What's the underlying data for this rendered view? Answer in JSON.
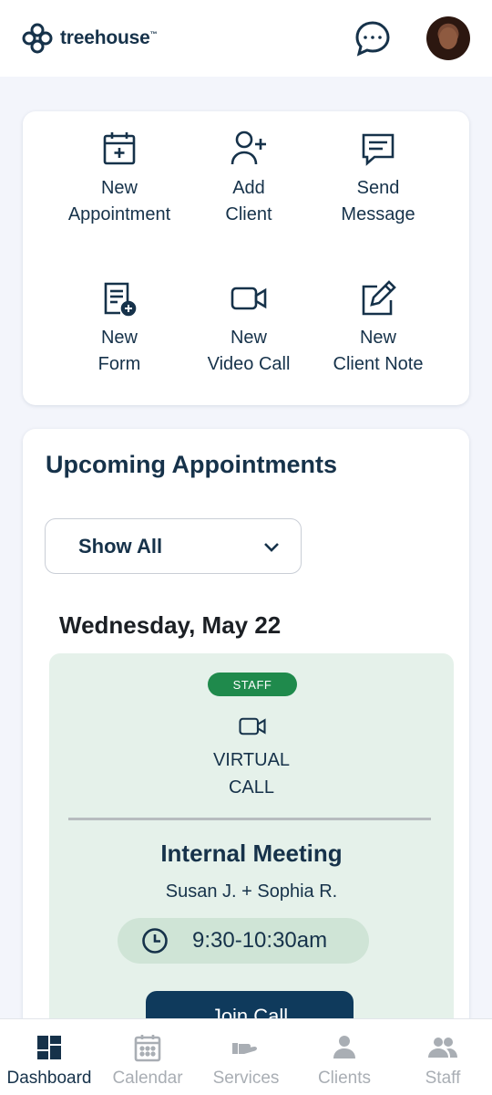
{
  "header": {
    "logo_text": "treehouse",
    "logo_mark": "™"
  },
  "quick_actions": [
    {
      "label": "New\nAppointment",
      "icon": "calendar-plus-icon"
    },
    {
      "label": "Add\nClient",
      "icon": "user-plus-icon"
    },
    {
      "label": "Send\nMessage",
      "icon": "message-icon"
    },
    {
      "label": "New\nForm",
      "icon": "form-add-icon"
    },
    {
      "label": "New\nVideo Call",
      "icon": "video-icon"
    },
    {
      "label": "New\nClient Note",
      "icon": "edit-note-icon"
    }
  ],
  "appointments": {
    "title": "Upcoming Appointments",
    "filter_value": "Show All",
    "date": "Wednesday, May 22",
    "items": [
      {
        "badge": "STAFF",
        "call_type": "VIRTUAL\nCALL",
        "title": "Internal Meeting",
        "participants": "Susan J. + Sophia R.",
        "time": "9:30-10:30am",
        "action_label": "Join Call"
      }
    ]
  },
  "bottom_nav": [
    {
      "label": "Dashboard",
      "icon": "dashboard-icon",
      "active": true
    },
    {
      "label": "Calendar",
      "icon": "calendar-icon",
      "active": false
    },
    {
      "label": "Services",
      "icon": "services-icon",
      "active": false
    },
    {
      "label": "Clients",
      "icon": "client-icon",
      "active": false
    },
    {
      "label": "Staff",
      "icon": "staff-icon",
      "active": false
    }
  ],
  "colors": {
    "primary": "#16324a",
    "staff_badge": "#1f8a4c",
    "appointment_bg": "#e5f1ea",
    "join_button": "#0f3a5c",
    "inactive_nav": "#a9aeb4"
  }
}
